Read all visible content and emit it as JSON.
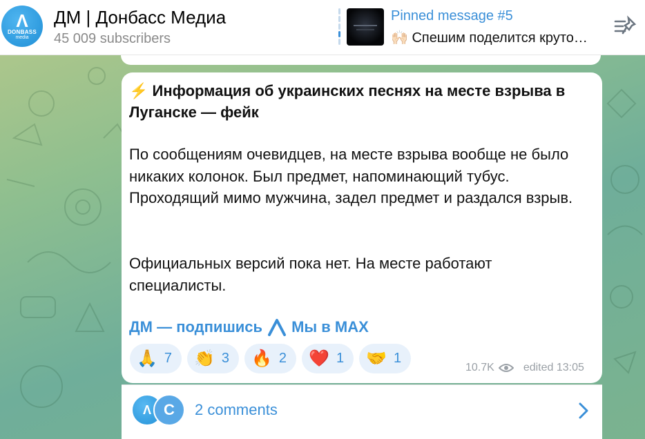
{
  "header": {
    "avatar_text_top": "DONBASS",
    "avatar_text_bottom": "media",
    "channel_title": "ДМ | Донбасс Медиа",
    "subscribers": "45 009 subscribers",
    "pinned_title": "Pinned message #5",
    "pinned_text": "🙌🏻 Спешим поделится круто…",
    "pin_list_icon": "pinned-list-icon"
  },
  "message": {
    "title": "⚡ Информация об украинских песнях на месте взрыва в Луганске — фейк",
    "paragraph1": "По сообщениям очевидцев, на месте взрыва вообще не было никаких колонок. Был предмет, напоминающий тубус. Проходящий мимо мужчина, задел предмет и раздался взрыв.",
    "paragraph2": "Официальных версий пока нет. На месте работают специалисты.",
    "link_subscribe": "ДМ — подпишись",
    "link_max": "Мы в MAX",
    "reactions": [
      {
        "emoji": "🙏",
        "count": "7"
      },
      {
        "emoji": "👏",
        "count": "3"
      },
      {
        "emoji": "🔥",
        "count": "2"
      },
      {
        "emoji": "❤️",
        "count": "1"
      },
      {
        "emoji": "🤝",
        "count": "1"
      }
    ],
    "views": "10.7K",
    "edited": "edited 13:05"
  },
  "comments": {
    "avatar2_letter": "C",
    "label": "2 comments"
  },
  "colors": {
    "accent": "#3a8fd8",
    "reaction_bg": "#e8f1fb",
    "meta": "#9aa0a6"
  }
}
